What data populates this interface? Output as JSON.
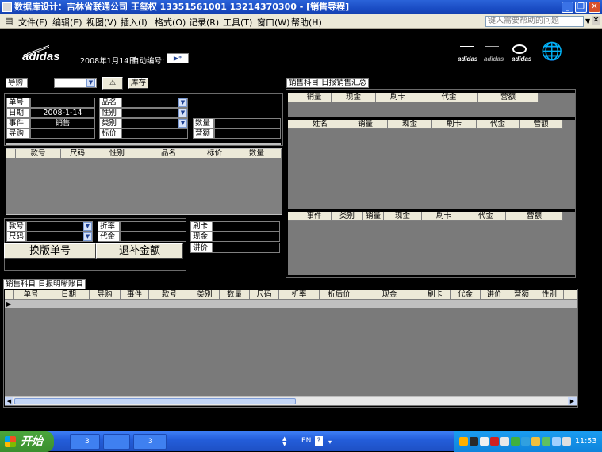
{
  "window": {
    "title": "数据库设计：吉林省联通公司 王玺权 13351561001  13214370300 - [销售导程]",
    "min": "_",
    "restore": "❐",
    "close": "✕"
  },
  "menu": {
    "items": [
      "文件(F)",
      "编辑(E)",
      "视图(V)",
      "插入(I)",
      "格式(O)",
      "记录(R)",
      "工具(T)",
      "窗口(W)",
      "帮助(H)"
    ],
    "help_placeholder": "键入需要帮助的问题",
    "close": "✕"
  },
  "header": {
    "logo_text": "adidas",
    "date": "2008年1月14日",
    "auto_no_label": "自动编号:",
    "auto_no_value": "▶*",
    "right_logos": [
      "adidas",
      "adidas",
      "adidas"
    ]
  },
  "guide_row": {
    "guide_label": "导购",
    "guide_value": "",
    "filter_btn": "⚠",
    "stock_btn": "库存"
  },
  "order": {
    "labels": {
      "order_no": "单号",
      "date": "日期",
      "event": "事件",
      "guide": "导购",
      "product": "品名",
      "gender": "性别",
      "category": "类别",
      "price": "标价",
      "qty": "数量",
      "revenue": "营额"
    },
    "values": {
      "order_no": "",
      "date": "2008-1-14",
      "event": "销售",
      "guide": "",
      "product": "",
      "gender": "",
      "category": "",
      "price": "",
      "qty": "",
      "revenue": ""
    }
  },
  "item_grid": {
    "headers": [
      "款号",
      "尺码",
      "性别",
      "品名",
      "标价",
      "数量"
    ]
  },
  "bottom_left": {
    "labels": {
      "style_no": "款号",
      "size": "尺码",
      "discount": "折率",
      "cash_voucher": "代金",
      "card": "刷卡",
      "cash": "现金",
      "bargain": "讲价"
    },
    "values": {
      "style_no": "",
      "size": "",
      "discount": "",
      "cash_voucher": "",
      "card": "",
      "cash": "",
      "bargain": ""
    },
    "change_btn": "换版单号",
    "refund_btn": "退补金额"
  },
  "summary": {
    "tab_label": "销售科目 日报销售汇总",
    "grid1_headers": [
      "销量",
      "现金",
      "刷卡",
      "代金",
      "营额"
    ],
    "grid2_headers": [
      "姓名",
      "销量",
      "现金",
      "刷卡",
      "代金",
      "营额"
    ],
    "grid3_headers": [
      "事件",
      "类别",
      "销量",
      "现金",
      "刷卡",
      "代金",
      "营额"
    ]
  },
  "detail": {
    "tab_label": "销售科目 日报明晰账目",
    "headers": [
      "单号",
      "日期",
      "导购",
      "事件",
      "款号",
      "类别",
      "数量",
      "尺码",
      "折率",
      "折后价",
      "现金",
      "刷卡",
      "代金",
      "讲价",
      "营额",
      "性别"
    ],
    "row_marker": "▶"
  },
  "taskbar": {
    "start_label": "开始",
    "tasks": [
      "3",
      "",
      "3"
    ],
    "lang": "EN",
    "time": "11:53"
  }
}
